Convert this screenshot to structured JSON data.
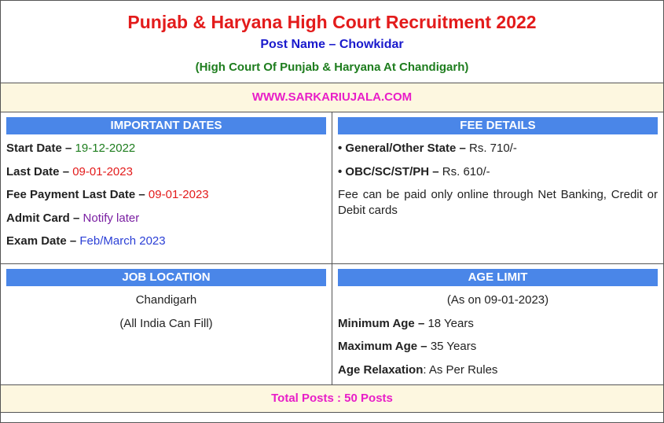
{
  "header": {
    "title": "Punjab & Haryana High Court Recruitment 2022",
    "post_name": "Post Name – Chowkidar",
    "court": "(High Court Of Punjab & Haryana At Chandigarh)"
  },
  "website": "WWW.SARKARIUJALA.COM",
  "important_dates": {
    "heading": "IMPORTANT DATES",
    "items": [
      {
        "label": "Start Date –",
        "value": "19-12-2022"
      },
      {
        "label": "Last Date –",
        "value": "09-01-2023"
      },
      {
        "label": "Fee Payment Last Date –",
        "value": "09-01-2023"
      },
      {
        "label": "Admit Card –",
        "value": "Notify later"
      },
      {
        "label": "Exam Date –",
        "value": "Feb/March 2023"
      }
    ]
  },
  "fee_details": {
    "heading": "FEE DETAILS",
    "items": [
      {
        "label": "• General/Other State –",
        "value": "Rs. 710/-"
      },
      {
        "label": "• OBC/SC/ST/PH –",
        "value": "Rs. 610/-"
      }
    ],
    "note": "Fee can be paid only online through Net Banking, Credit or Debit cards"
  },
  "job_location": {
    "heading": "JOB LOCATION",
    "city": "Chandigarh",
    "note": "(All India Can Fill)"
  },
  "age_limit": {
    "heading": "AGE LIMIT",
    "as_on": "(As on 09-01-2023)",
    "items": [
      {
        "label": "Minimum Age –",
        "value": "18 Years"
      },
      {
        "label": "Maximum Age –",
        "value": "35 Years"
      },
      {
        "label": "Age Relaxation",
        "value": ": As Per Rules"
      }
    ]
  },
  "total_posts": "Total Posts : 50 Posts",
  "colors": {
    "title": "#e31b1b",
    "subtitle": "#1a1acc",
    "court": "#1e7d1e",
    "website": "#e81ec8",
    "section_header": "#4a86e8",
    "highlight_bg": "#fdf7e0"
  }
}
